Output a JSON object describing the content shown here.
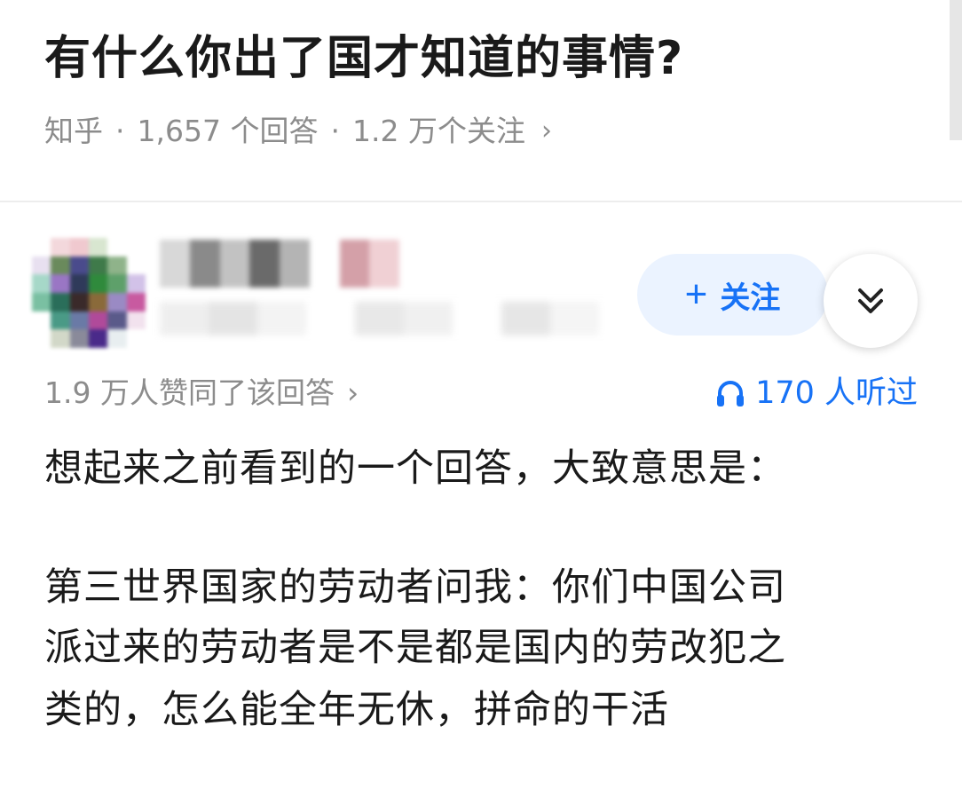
{
  "question": {
    "title": "有什么你出了国才知道的事情?",
    "source": "知乎",
    "separator": "·",
    "answers": "1,657 个回答",
    "followers": "1.2 万个关注",
    "chevron": "›"
  },
  "author": {
    "avatar_icon": "blurred-avatar",
    "follow_label": "关注",
    "follow_icon": "plus-icon",
    "expand_icon": "double-chevron-down-icon"
  },
  "stats": {
    "upvotes": "1.9 万人赞同了该回答",
    "chevron": "›",
    "listeners": "170 人听过",
    "listen_icon": "headphones-icon"
  },
  "answer": {
    "lines": [
      "想起来之前看到的一个回答，大致意思是：",
      "第三世界国家的劳动者问我：你们中国公司",
      "派过来的劳动者是不是都是国内的劳改犯之",
      "类的，怎么能全年无休，拼命的干活"
    ]
  },
  "colors": {
    "accent": "#1772f6",
    "follow_bg": "#ebf3ff",
    "meta_gray": "#8c8c8c",
    "text": "#1a1a1a"
  }
}
